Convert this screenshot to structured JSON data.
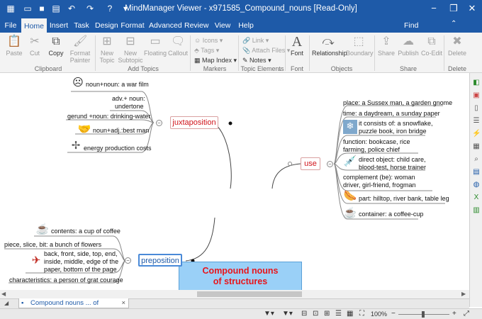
{
  "window": {
    "title": "MindManager Viewer - x971585_Compound_nouns [Read-Only]",
    "controls": {
      "minimize": "−",
      "restore": "❐",
      "close": "✕"
    }
  },
  "tabs": [
    "File",
    "Home",
    "Insert",
    "Task",
    "Design",
    "Format",
    "Advanced",
    "Review",
    "View",
    "Help"
  ],
  "active_tab": "Home",
  "find_label": "Find",
  "ribbon": {
    "clipboard": {
      "paste": "Paste",
      "cut": "Cut",
      "copy": "Copy",
      "format_painter": [
        "Format",
        "Painter"
      ],
      "group": "Clipboard"
    },
    "add_topics": {
      "new_topic": [
        "New",
        "Topic"
      ],
      "new_subtopic": [
        "New",
        "Subtopic"
      ],
      "floating": "Floating",
      "callout": "Callout",
      "group": "Add Topics"
    },
    "markers": {
      "icons": "Icons",
      "tags": "Tags",
      "map_index": "Map Index",
      "group": "Markers"
    },
    "topic_elements": {
      "link": "Link",
      "attach_files": "Attach Files",
      "notes": "Notes",
      "group": "Topic Elements"
    },
    "font": {
      "font": "Font",
      "group": "Font"
    },
    "objects": {
      "relationship": "Relationship",
      "boundary": "Boundary",
      "group": "Objects"
    },
    "share": {
      "share": "Share",
      "publish": "Publish",
      "coedit": "Co-Edit",
      "group": "Share"
    },
    "delete": {
      "delete": "Delete",
      "group": "Delete"
    }
  },
  "map": {
    "central": [
      "Compound nouns",
      "of structures"
    ],
    "juxtaposition": {
      "label": "juxtaposition",
      "items": [
        "noun+noun: a war film",
        [
          "adv.+ noun:",
          "undertone"
        ],
        "gerund +noun: drinking-water",
        "noun+adj.:best man",
        "energy production costs"
      ]
    },
    "use": {
      "label": "use",
      "items": [
        "place: a Sussex man, a garden gnome",
        "time: a daydream, a sunday paper",
        [
          "it consists of: a snowflake,",
          "puzzle book, iron bridge"
        ],
        [
          "function: bookcase, rice",
          "farming, police chief"
        ],
        [
          "direct object: child care,",
          "blood-test, horse trainer"
        ],
        [
          "complement (be): woman",
          "driver, girl-friend, frogman"
        ],
        "part: hilltop, river bank, table leg",
        "container: a coffee-cup"
      ]
    },
    "preposition": {
      "label": "preposition",
      "items": [
        "contents: a cup of coffee",
        "piece, slice, bit: a bunch of flowers",
        [
          "back, front, side, top, end,",
          "inside, middle, edge of the",
          "paper, bottom of the page"
        ],
        "characteristics: a person of grat courage"
      ]
    }
  },
  "document_tab": "Compound nouns ... of structures",
  "status": {
    "zoom": "100%"
  },
  "colors": {
    "titlebar": "#1e5aa8",
    "central_fill": "#9ad0f7",
    "central_text": "#e8151b",
    "juxtaposition_text": "#d0131a",
    "preposition_text": "#1e5aa8"
  }
}
